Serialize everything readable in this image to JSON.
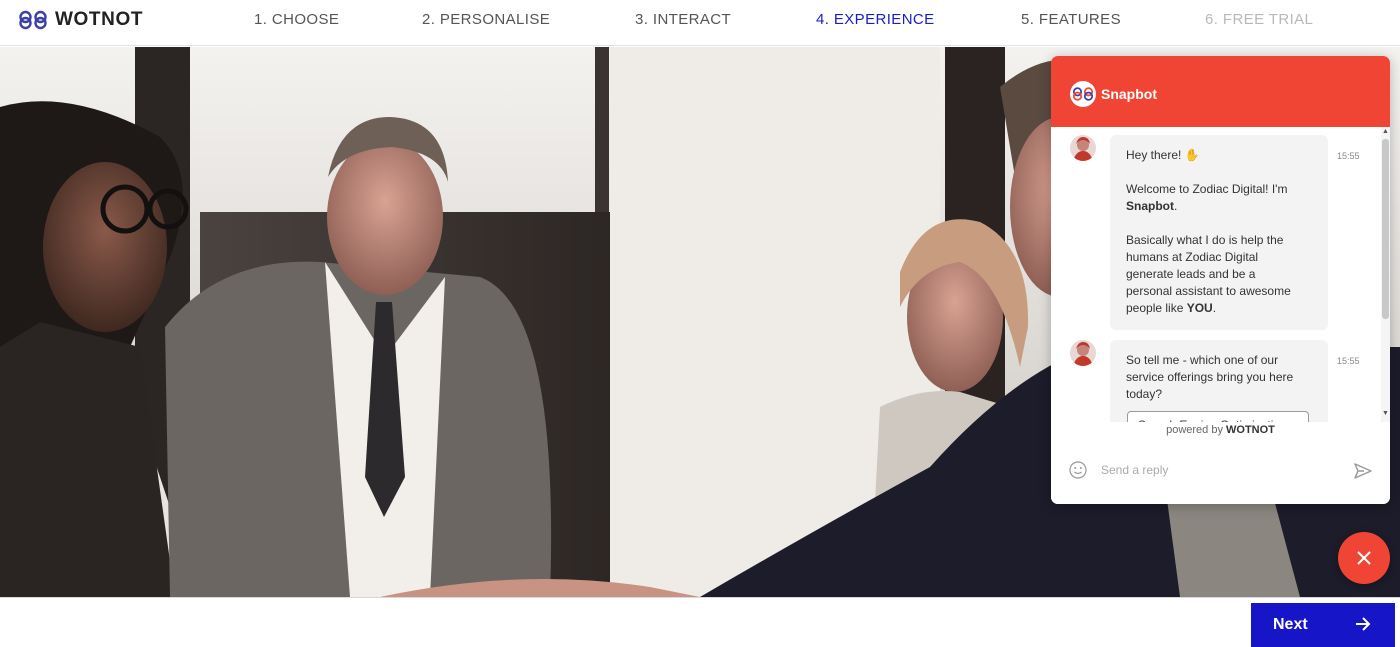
{
  "brand": {
    "name": "WOTNOT",
    "accent": "#1a1ec8"
  },
  "steps": [
    {
      "label": "1. CHOOSE",
      "state": "done"
    },
    {
      "label": "2. PERSONALISE",
      "state": "done"
    },
    {
      "label": "3. INTERACT",
      "state": "done"
    },
    {
      "label": "4. EXPERIENCE",
      "state": "active"
    },
    {
      "label": "5. FEATURES",
      "state": "upcoming"
    },
    {
      "label": "6. FREE TRIAL",
      "state": "disabled"
    }
  ],
  "hero": {
    "image": "business-people-handshake-photo"
  },
  "chat": {
    "bot_name": "Snapbot",
    "header_color": "#f04535",
    "messages": [
      {
        "time": "15:55",
        "greeting": "Hey there!",
        "emoji": "wave-icon",
        "line1": "Welcome to Zodiac Digital! I'm",
        "line1_bold": "Snapbot",
        "line1_end": ".",
        "para": [
          "Basically what I do is help the",
          "humans at Zodiac Digital",
          "generate leads and be a",
          "personal assistant to awesome"
        ],
        "last_pre": "people like ",
        "last_bold": "YOU",
        "last_end": "."
      },
      {
        "time": "15:55",
        "lines": [
          "So tell me - which one of our",
          "service offerings bring you here",
          "today?"
        ]
      }
    ],
    "option": "Search Engine Optimisation",
    "powered_prefix": "powered by",
    "powered_brand": "WOTNOT",
    "reply_placeholder": "Send a reply"
  },
  "next_button": {
    "label": "Next"
  }
}
